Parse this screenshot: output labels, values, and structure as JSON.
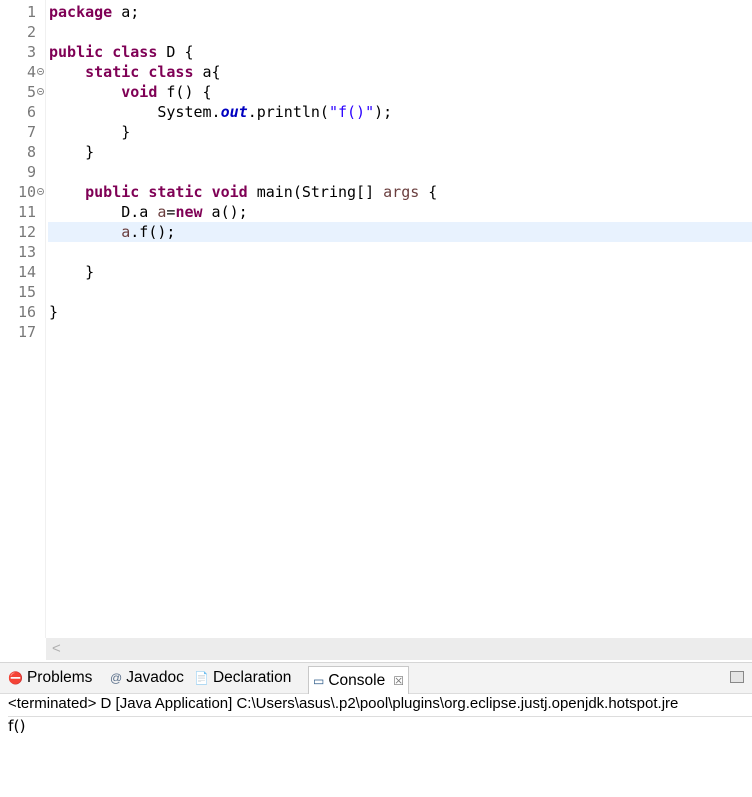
{
  "editor": {
    "lines": [
      {
        "n": "1",
        "parts": [
          [
            "kw",
            "package"
          ],
          [
            "",
            " a;"
          ]
        ]
      },
      {
        "n": "2",
        "parts": []
      },
      {
        "n": "3",
        "parts": [
          [
            "kw",
            "public"
          ],
          [
            "",
            " "
          ],
          [
            "kw",
            "class"
          ],
          [
            "",
            " D {"
          ]
        ]
      },
      {
        "n": "4",
        "fold": true,
        "parts": [
          [
            "",
            "    "
          ],
          [
            "kw",
            "static"
          ],
          [
            "",
            " "
          ],
          [
            "kw",
            "class"
          ],
          [
            "",
            " a{"
          ]
        ]
      },
      {
        "n": "5",
        "fold": true,
        "parts": [
          [
            "",
            "        "
          ],
          [
            "kw",
            "void"
          ],
          [
            "",
            " f() {"
          ]
        ]
      },
      {
        "n": "6",
        "parts": [
          [
            "",
            "            System."
          ],
          [
            "fld",
            "out"
          ],
          [
            "",
            ".println("
          ],
          [
            "str",
            "\"f()\""
          ],
          [
            "",
            ");"
          ]
        ]
      },
      {
        "n": "7",
        "parts": [
          [
            "",
            "        }"
          ]
        ]
      },
      {
        "n": "8",
        "parts": [
          [
            "",
            "    }"
          ]
        ]
      },
      {
        "n": "9",
        "parts": []
      },
      {
        "n": "10",
        "fold": true,
        "parts": [
          [
            "",
            "    "
          ],
          [
            "kw",
            "public"
          ],
          [
            "",
            " "
          ],
          [
            "kw",
            "static"
          ],
          [
            "",
            " "
          ],
          [
            "kw",
            "void"
          ],
          [
            "",
            " main(String[] "
          ],
          [
            "var",
            "args"
          ],
          [
            "",
            " {"
          ]
        ]
      },
      {
        "n": "11",
        "parts": [
          [
            "",
            "        D.a "
          ],
          [
            "var",
            "a"
          ],
          [
            "",
            "="
          ],
          [
            "kw",
            "new"
          ],
          [
            "",
            " a();"
          ]
        ]
      },
      {
        "n": "12",
        "current": true,
        "parts": [
          [
            "",
            "        "
          ],
          [
            "var",
            "a"
          ],
          [
            "",
            ".f();"
          ]
        ]
      },
      {
        "n": "13",
        "parts": []
      },
      {
        "n": "14",
        "parts": [
          [
            "",
            "    }"
          ]
        ]
      },
      {
        "n": "15",
        "parts": []
      },
      {
        "n": "16",
        "parts": [
          [
            "",
            "}"
          ]
        ]
      },
      {
        "n": "17",
        "parts": []
      }
    ],
    "scroll_left_glyph": "<"
  },
  "panel": {
    "tabs": [
      {
        "label": "Problems",
        "icon": "problems-icon",
        "glyph": "⛔",
        "color": "#c0392b"
      },
      {
        "label": "Javadoc",
        "icon": "javadoc-icon",
        "glyph": "@",
        "color": "#5a6f8a"
      },
      {
        "label": "Declaration",
        "icon": "declaration-icon",
        "glyph": "📄",
        "color": "#8a6d1f"
      },
      {
        "label": "Console",
        "icon": "console-icon",
        "glyph": "▭",
        "color": "#2f5d8a",
        "active": true,
        "close": "☒"
      }
    ],
    "console_header": "<terminated> D [Java Application] C:\\Users\\asus\\.p2\\pool\\plugins\\org.eclipse.justj.openjdk.hotspot.jre",
    "console_output": "f()"
  },
  "colors": {
    "keyword": "#7f0055",
    "string": "#2a00ff",
    "field": "#0000c0",
    "local_var": "#6a3e3e",
    "current_line": "#e8f2fe"
  }
}
